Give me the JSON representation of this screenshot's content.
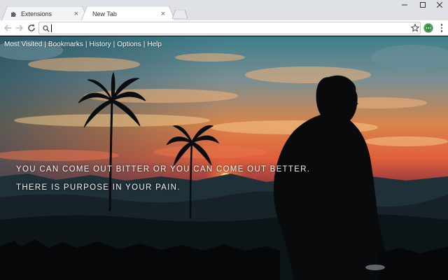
{
  "browser": {
    "tabs": [
      {
        "title": "Extensions",
        "icon": "puzzle-icon",
        "active": false
      },
      {
        "title": "New Tab",
        "icon": "none",
        "active": true
      }
    ],
    "omnibox": {
      "value": "",
      "placeholder": ""
    }
  },
  "nav": {
    "most_visited": "Most Visited",
    "bookmarks": "Bookmarks",
    "history": "History",
    "options": "Options",
    "help": "Help",
    "separator": "|"
  },
  "quote": {
    "line1": "YOU CAN COME OUT BITTER OR YOU CAN COME OUT BETTER.",
    "line2": "THERE IS PURPOSE IN YOUR PAIN."
  },
  "colors": {
    "tabstrip_bg": "#dee1e6",
    "active_tab_bg": "#ffffff",
    "extension_badge": "#1e7f2e"
  }
}
